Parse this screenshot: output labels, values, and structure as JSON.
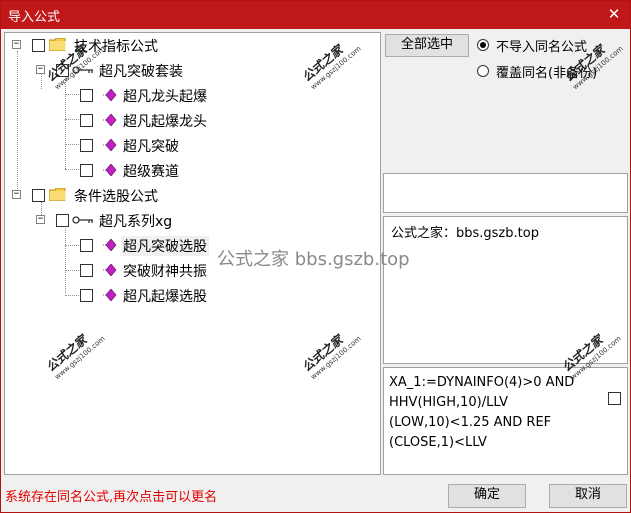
{
  "window": {
    "title": "导入公式",
    "close_glyph": "✕"
  },
  "tree": {
    "tech_root": "技术指标公式",
    "tech_group": "超凡突破套装",
    "tech_items": [
      "超凡龙头起爆",
      "超凡起爆龙头",
      "超凡突破",
      "超级赛道"
    ],
    "cond_root": "条件选股公式",
    "cond_group": "超凡系列xg",
    "cond_items": [
      "超凡突破选股",
      "突破财神共振",
      "超凡起爆选股"
    ]
  },
  "watermark": {
    "name": "公式之家",
    "url": "www.gszj100.com"
  },
  "overlay_text": "公式之家 bbs.gszb.top",
  "options": {
    "select_all": "全部选中",
    "radio_skip": "不导入同名公式",
    "radio_overwrite": "覆盖同名(非备份)",
    "radio_selected": "skip"
  },
  "info_text": "公式之家：bbs.gszb.top",
  "formula_text": "XA_1:=DYNAINFO(4)>0 AND\nHHV(HIGH,10)/LLV\n(LOW,10)<1.25 AND REF\n(CLOSE,1)<LLV",
  "status_message": "系统存在同名公式,再次点击可以更名",
  "buttons": {
    "ok": "确定",
    "cancel": "取消"
  }
}
